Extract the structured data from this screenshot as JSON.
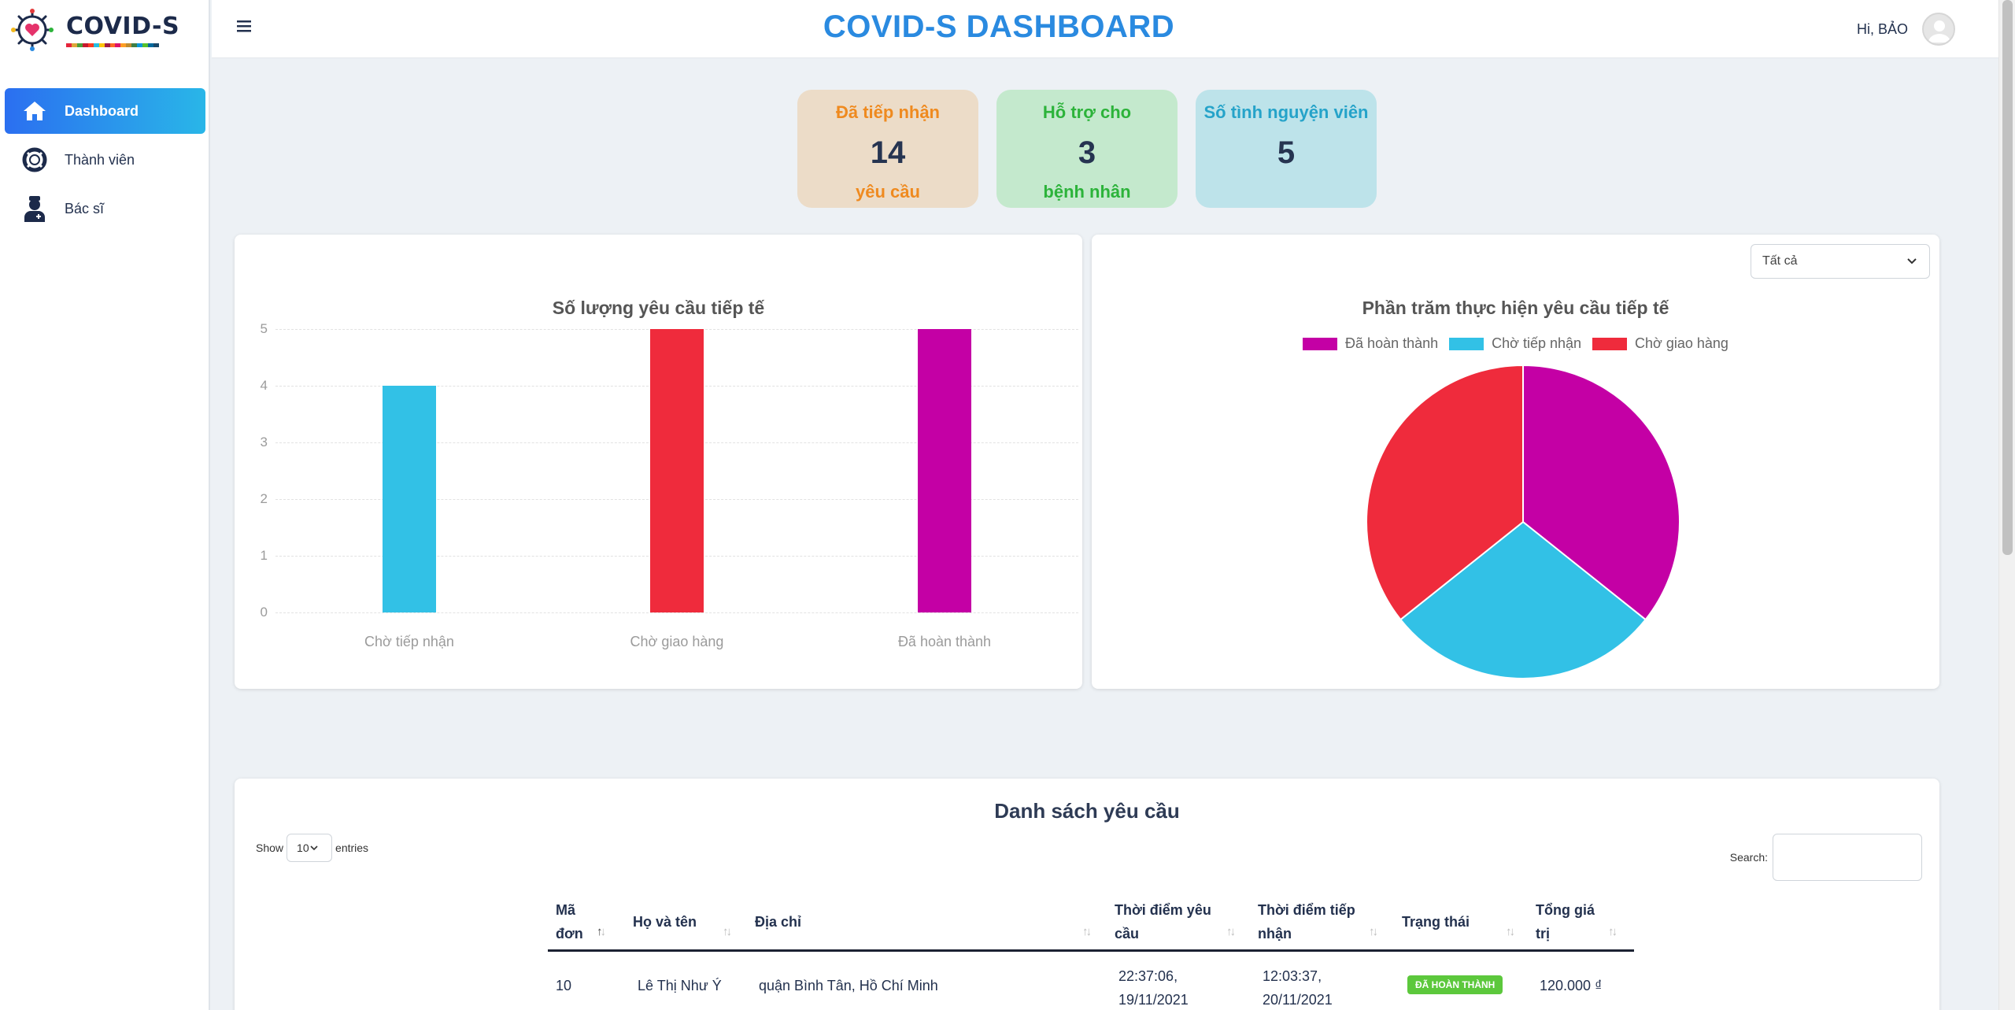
{
  "brand": {
    "name": "COVID-S"
  },
  "sidebar": {
    "items": [
      {
        "label": "Dashboard",
        "icon": "home-icon",
        "active": true
      },
      {
        "label": "Thành viên",
        "icon": "lifebuoy-icon"
      },
      {
        "label": "Bác sĩ",
        "icon": "doctor-icon"
      }
    ]
  },
  "header": {
    "title": "COVID-S DASHBOARD",
    "greeting": "Hi, BẢO"
  },
  "stats": [
    {
      "top": "Đã tiếp nhận",
      "value": "14",
      "bottom": "yêu cầu",
      "bg": "#ecdcc8",
      "color": "#ef8a1f"
    },
    {
      "top": "Hỗ trợ cho",
      "value": "3",
      "bottom": "bệnh nhân",
      "bg": "#c4e9cd",
      "color": "#2cb33a"
    },
    {
      "top": "Số tình nguyện viên",
      "value": "5",
      "bottom": "",
      "bg": "#bde3ea",
      "color": "#25a3c9"
    }
  ],
  "bar_chart": {
    "chart_data": {
      "type": "bar",
      "title": "Số lượng yêu cầu tiếp tế",
      "categories": [
        "Chờ tiếp nhận",
        "Chờ giao hàng",
        "Đã hoàn thành"
      ],
      "values": [
        4,
        5,
        5
      ],
      "colors": [
        "#32c1e6",
        "#ef2b3c",
        "#c400a5"
      ],
      "ylim": [
        0,
        5
      ],
      "yticks": [
        "0",
        "1",
        "2",
        "3",
        "4",
        "5"
      ],
      "grid": true
    }
  },
  "pie_chart": {
    "filter": "Tất cả",
    "chart_data": {
      "type": "pie",
      "title": "Phần trăm thực hiện yêu cầu tiếp tế",
      "labels": [
        "Đã hoàn thành",
        "Chờ tiếp nhận",
        "Chờ giao hàng"
      ],
      "values": [
        5,
        4,
        5
      ],
      "colors": [
        "#c400a5",
        "#32c1e6",
        "#ef2b3c"
      ],
      "legend": "top"
    }
  },
  "table": {
    "title": "Danh sách yêu cầu",
    "show_label": "Show",
    "entries_value": "10",
    "entries_label": "entries",
    "search_label": "Search:",
    "columns": [
      {
        "l1": "Mã",
        "l2": "đơn"
      },
      {
        "l1": "Họ và tên",
        "l2": ""
      },
      {
        "l1": "Địa chỉ",
        "l2": ""
      },
      {
        "l1": "Thời điểm yêu",
        "l2": "cầu"
      },
      {
        "l1": "Thời điểm tiếp",
        "l2": "nhận"
      },
      {
        "l1": "Trạng thái",
        "l2": ""
      },
      {
        "l1": "Tổng giá",
        "l2": "trị"
      }
    ],
    "rows": [
      {
        "id": "10",
        "name": "Lê Thị Như Ý",
        "address": "quận Bình Tân, Hồ Chí Minh",
        "requested_1": "22:37:06,",
        "requested_2": "19/11/2021",
        "received_1": "12:03:37,",
        "received_2": "20/11/2021",
        "status": "ĐÃ HOÀN THÀNH",
        "total": "120.000 ₫"
      }
    ]
  }
}
